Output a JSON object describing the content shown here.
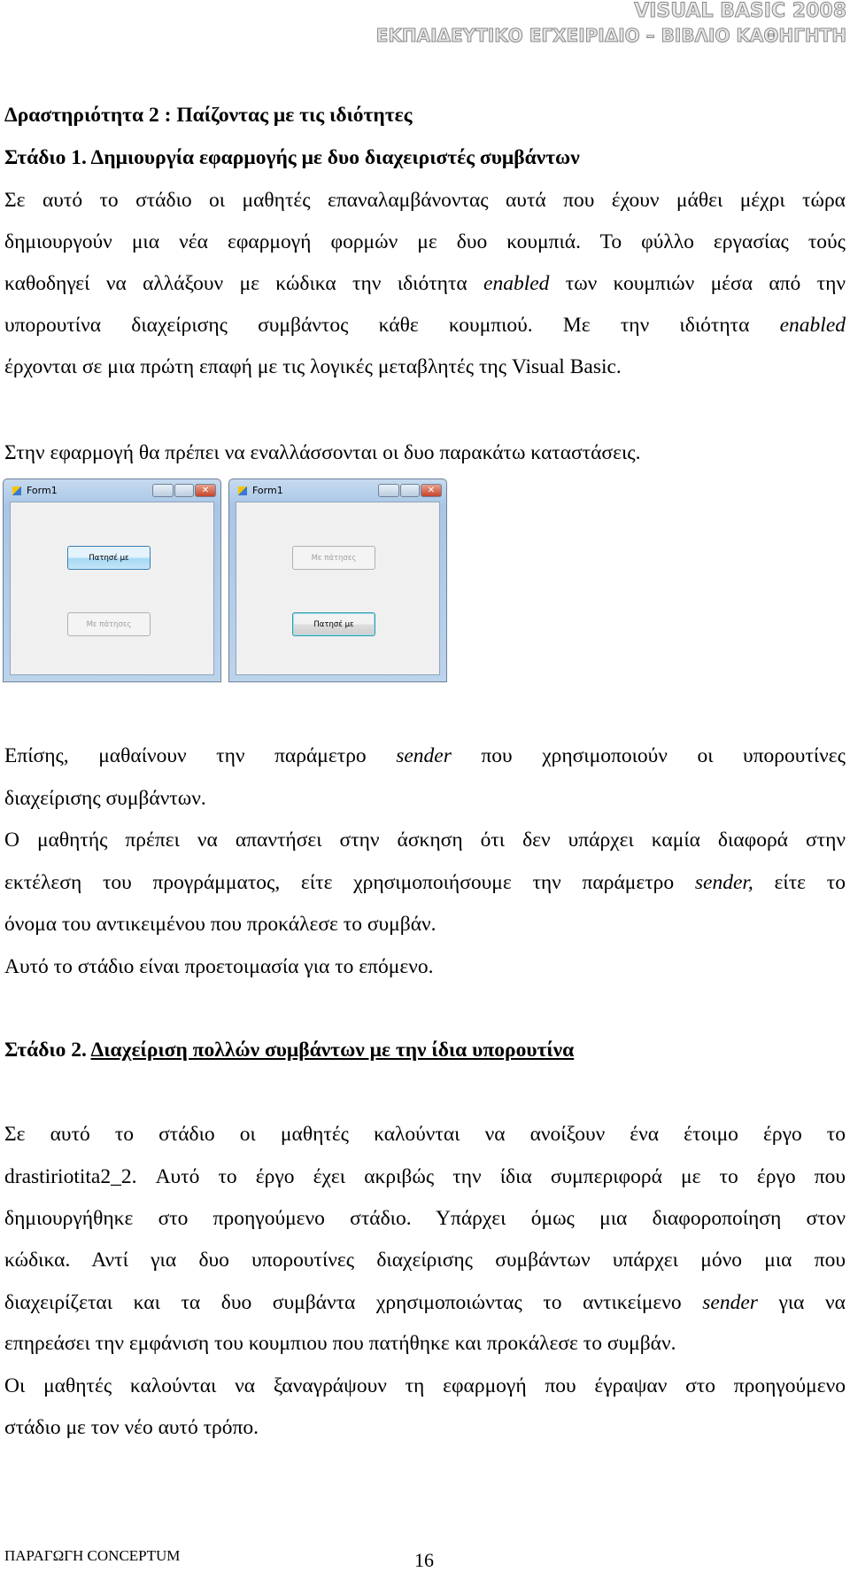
{
  "header": {
    "line1": "VISUAL BASIC 2008",
    "line2": "ΕΚΠΑΙΔΕΥΤΙΚΟ ΕΓΧΕΙΡΙΔΙΟ – ΒΙΒΛΙΟ ΚΑΘΗΓΗΤΗ"
  },
  "activity_title": "Δραστηριότητα 2 : Παίζοντας με τις ιδιότητες",
  "stage1_title": "Στάδιο 1. Δημιουργία εφαρμογής με δυο διαχειριστές συμβάντων",
  "stage2_title": {
    "prefix": "Στάδιο 2. ",
    "text": "Διαχείριση πολλών συμβάντων με την ίδια υπορουτίνα"
  },
  "lines": [
    [
      [
        "Σε αυτό το στάδιο οι μαθητές επαναλαμβάνοντας αυτά που έχουν μάθει μέχρι τώρα",
        0
      ]
    ],
    [
      [
        "δημιουργούν μια νέα εφαρμογή φορμών με δυο κουμπιά. Το φύλλο εργασίας τούς",
        0
      ]
    ],
    [
      [
        "καθοδηγεί να αλλάξουν με κώδικα την ιδιότητα ",
        0
      ],
      [
        "enabled",
        1
      ],
      [
        " των κουμπιών μέσα από την",
        0
      ]
    ],
    [
      [
        "υπορουτίνα διαχείρισης συμβάντος κάθε κουμπιού. Με την  ιδιότητα ",
        0
      ],
      [
        "enabled",
        1
      ]
    ],
    [
      [
        "έρχονται σε μια πρώτη επαφή με τις λογικές μεταβλητές της Visual Basic.",
        0
      ]
    ],
    [
      [
        "Στην εφαρμογή θα πρέπει να εναλλάσσονται οι δυο παρακάτω καταστάσεις.",
        0
      ]
    ],
    [
      [
        "Επίσης, μαθαίνουν την παράμετρο ",
        0
      ],
      [
        "sender",
        1
      ],
      [
        " που χρησιμοποιούν οι υπορουτίνες",
        0
      ]
    ],
    [
      [
        "διαχείρισης συμβάντων.",
        0
      ]
    ],
    [
      [
        "Ο μαθητής πρέπει να απαντήσει στην άσκηση ότι δεν υπάρχει καμία διαφορά στην",
        0
      ]
    ],
    [
      [
        "εκτέλεση του προγράμματος, είτε χρησιμοποιήσουμε την παράμετρο ",
        0
      ],
      [
        "sender,",
        1
      ],
      [
        " είτε το",
        0
      ]
    ],
    [
      [
        "όνομα του αντικειμένου που προκάλεσε το συμβάν.",
        0
      ]
    ],
    [
      [
        "Αυτό το στάδιο είναι προετοιμασία για το επόμενο.",
        0
      ]
    ],
    [
      [
        "Σε αυτό το στάδιο οι μαθητές καλούνται να ανοίξουν ένα έτοιμο έργο το",
        0
      ]
    ],
    [
      [
        "drastiriotita2_2. Αυτό το έργο έχει ακριβώς την ίδια συμπεριφορά με το έργο που",
        0
      ]
    ],
    [
      [
        "δημιουργήθηκε στο προηγούμενο στάδιο. Υπάρχει όμως μια διαφοροποίηση στον",
        0
      ]
    ],
    [
      [
        "κώδικα. Αντί για δυο υπορουτίνες διαχείρισης συμβάντων υπάρχει μόνο μια που",
        0
      ]
    ],
    [
      [
        "διαχειρίζεται και τα δυο συμβάντα χρησιμοποιώντας το αντικείμενο ",
        0
      ],
      [
        "sender",
        1
      ],
      [
        " για να",
        0
      ]
    ],
    [
      [
        "επηρεάσει την εμφάνιση του κουμπιου που πατήθηκε και προκάλεσε το συμβάν.",
        0
      ]
    ],
    [
      [
        "Οι μαθητές καλούνται να ξαναγράψουν τη εφαρμογή που έγραψαν στο προηγούμενο",
        0
      ]
    ],
    [
      [
        "στάδιο με τον νέο αυτό τρόπο.",
        0
      ]
    ]
  ],
  "forms": [
    {
      "title": "Form1",
      "button_top": {
        "label": "Πατησέ με",
        "state": "enabled"
      },
      "button_bottom": {
        "label": "Με πάτησες",
        "state": "disabled"
      }
    },
    {
      "title": "Form1",
      "button_top": {
        "label": "Με πάτησες",
        "state": "disabled"
      },
      "button_bottom": {
        "label": "Πατησέ με",
        "state": "enabled"
      }
    }
  ],
  "footer": {
    "publisher": "ΠΑΡΑΓΩΓΗ CONCEPTUM",
    "page_number": "16"
  }
}
